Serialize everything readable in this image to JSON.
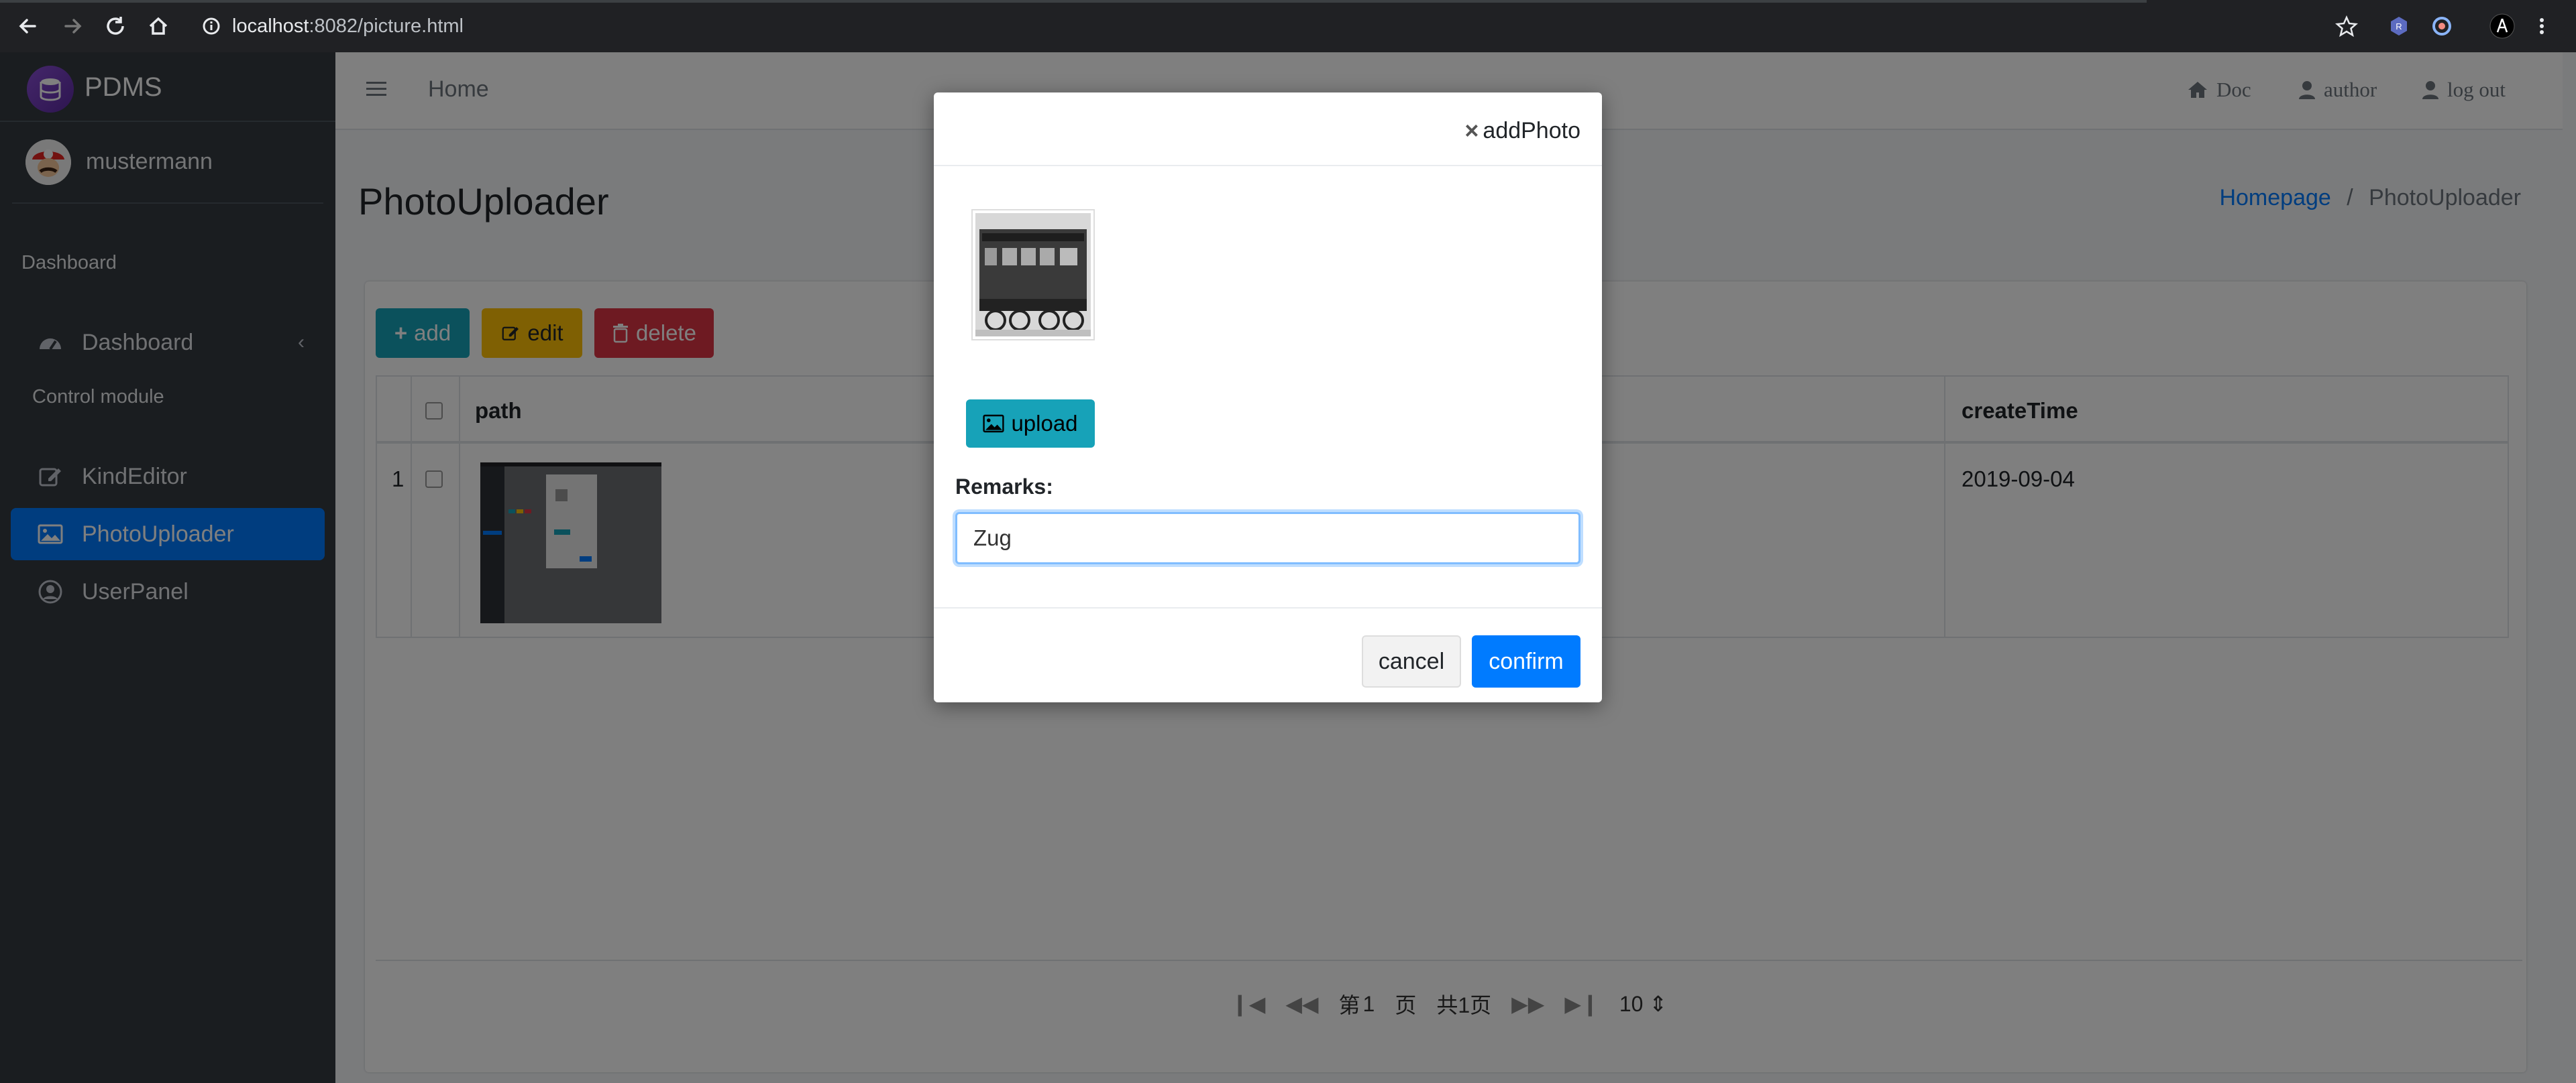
{
  "browser": {
    "url_host": "localhost",
    "url_rest": ":8082/picture.html"
  },
  "sidebar": {
    "brand": "PDMS",
    "user": "mustermann",
    "sections": [
      {
        "header": "Dashboard",
        "items": [
          {
            "label": "Dashboard",
            "icon": "tachometer-icon"
          }
        ]
      },
      {
        "header": "Control module",
        "items": [
          {
            "label": "KindEditor",
            "icon": "edit-icon"
          },
          {
            "label": "PhotoUploader",
            "icon": "image-icon",
            "active": true
          },
          {
            "label": "UserPanel",
            "icon": "user-circle-icon"
          }
        ]
      }
    ]
  },
  "topnav": {
    "home": "Home",
    "links": [
      "Doc",
      "author",
      "log out"
    ]
  },
  "page": {
    "title": "PhotoUploader",
    "breadcrumb": [
      "Homepage",
      "/",
      "PhotoUploader"
    ]
  },
  "toolbar": {
    "add": "add",
    "edit": "edit",
    "delete": "delete"
  },
  "table": {
    "columns": [
      "path",
      "createTime"
    ],
    "rows": [
      {
        "index": "1",
        "createTime": "2019-09-04"
      }
    ]
  },
  "pager": {
    "page_prefix": "第",
    "page_number": "1",
    "page_suffix": "页",
    "total": "共1页",
    "page_size": "10"
  },
  "modal": {
    "title": "addPhoto",
    "upload_label": "upload",
    "remarks_label": "Remarks:",
    "remarks_value": "Zug",
    "cancel_label": "cancel",
    "confirm_label": "confirm"
  },
  "colors": {
    "primary": "#007bff",
    "info": "#17a2b8",
    "warning": "#ffc107",
    "danger": "#dc3545",
    "sidebar": "#343a40"
  }
}
